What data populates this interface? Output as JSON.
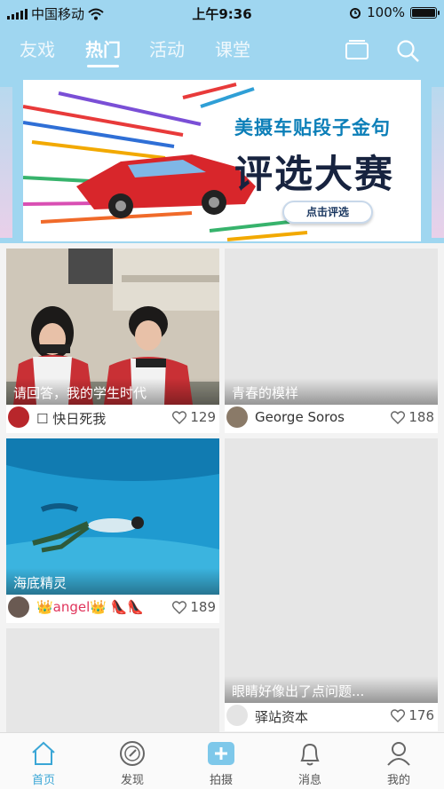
{
  "status_bar": {
    "carrier": "中国移动",
    "time": "上午9:36",
    "battery": "100%",
    "battery_level": 1.0
  },
  "top_tabs": [
    {
      "label": "友戏",
      "active": false
    },
    {
      "label": "热门",
      "active": true
    },
    {
      "label": "活动",
      "active": false
    },
    {
      "label": "课堂",
      "active": false
    }
  ],
  "header_icons": [
    "tv-icon",
    "search-icon"
  ],
  "banner": {
    "title_line1": "美摄车贴段子金句",
    "title_line2": "评选大赛",
    "button_label": "点击评选"
  },
  "feed": [
    {
      "caption": "请回答，我的学生时代",
      "user": "☐ 快日死我",
      "likes": "129"
    },
    {
      "caption": "青春的模样",
      "user": "George Soros",
      "likes": "188"
    },
    {
      "caption": "海底精灵",
      "user": "👑angel👑 👠👠",
      "likes": "189"
    },
    {
      "caption": "眼睛好像出了点问题...",
      "user": "驿站资本",
      "likes": "176"
    }
  ],
  "bottom_nav": [
    {
      "label": "首页",
      "icon": "home-icon",
      "active": true
    },
    {
      "label": "发现",
      "icon": "discover-icon",
      "active": false
    },
    {
      "label": "拍摄",
      "icon": "plus-icon",
      "active": false
    },
    {
      "label": "消息",
      "icon": "bell-icon",
      "active": false
    },
    {
      "label": "我的",
      "icon": "user-icon",
      "active": false
    }
  ],
  "colors": {
    "accent": "#3aa6d6",
    "header_bg": "#9fd6f0"
  }
}
